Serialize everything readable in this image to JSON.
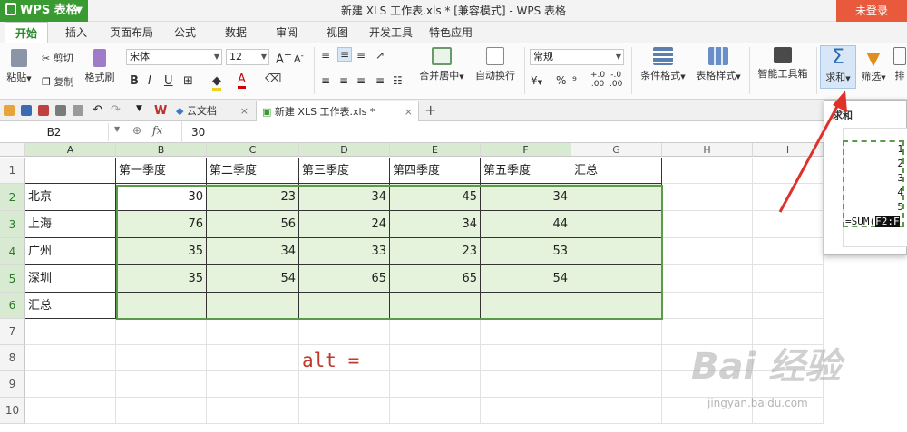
{
  "app": {
    "name": "WPS 表格",
    "title": "新建 XLS 工作表.xls * [兼容模式] - WPS 表格",
    "login": "未登录"
  },
  "ribbon_tabs": [
    "开始",
    "插入",
    "页面布局",
    "公式",
    "数据",
    "审阅",
    "视图",
    "开发工具",
    "特色应用"
  ],
  "ribbon": {
    "paste": "粘贴",
    "cut": "剪切",
    "copy": "复制",
    "format_painter": "格式刷",
    "font": "宋体",
    "font_size": "12",
    "merge_center": "合并居中",
    "wrap": "自动换行",
    "number_format": "常规",
    "cond_format": "条件格式",
    "table_style": "表格样式",
    "smart_toolbox": "智能工具箱",
    "sum": "求和",
    "filter": "筛选",
    "sort": "排",
    "pct": "%",
    "thousands": "⁹",
    "dec_inc": ".00",
    "dec_dec": ".00"
  },
  "doc_tabs": [
    "云文档",
    "新建 XLS 工作表.xls *"
  ],
  "formula_bar": {
    "cell_ref": "B2",
    "fx": "fx",
    "value": "30"
  },
  "columns": [
    "A",
    "B",
    "C",
    "D",
    "E",
    "F",
    "G",
    "H",
    "I"
  ],
  "rows": [
    "1",
    "2",
    "3",
    "4",
    "5",
    "6",
    "7",
    "8",
    "9",
    "10"
  ],
  "table": {
    "header": [
      "",
      "第一季度",
      "第二季度",
      "第三季度",
      "第四季度",
      "第五季度",
      "汇总"
    ],
    "rows": [
      [
        "北京",
        "30",
        "23",
        "34",
        "45",
        "34",
        ""
      ],
      [
        "上海",
        "76",
        "56",
        "24",
        "34",
        "44",
        ""
      ],
      [
        "广州",
        "35",
        "34",
        "33",
        "23",
        "53",
        ""
      ],
      [
        "深圳",
        "35",
        "54",
        "65",
        "65",
        "54",
        ""
      ],
      [
        "汇总",
        "",
        "",
        "",
        "",
        "",
        ""
      ]
    ]
  },
  "annotation": "alt =",
  "popup": {
    "title": "求和",
    "nums": [
      "1",
      "2",
      "3",
      "4",
      "5"
    ],
    "formula_prefix": "=SUM(",
    "formula_hl": "F2:F"
  },
  "watermark": {
    "text": "Bai 经验",
    "url": "jingyan.baidu.com"
  },
  "colors": {
    "accent": "#3a9a32",
    "selection": "#e6f3dc",
    "login": "#e95a3c",
    "arrow": "#e0302a"
  }
}
